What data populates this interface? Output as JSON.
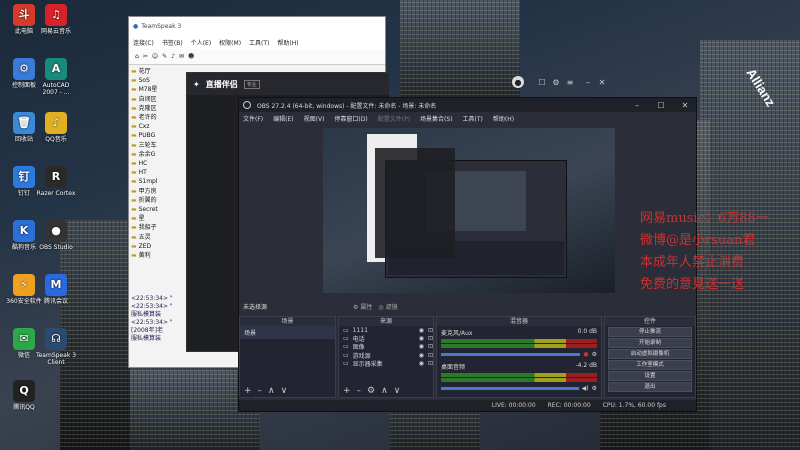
{
  "desktop": {
    "icons": [
      {
        "label": "此电脑",
        "glyph": "斗"
      },
      {
        "label": "网易云音乐",
        "glyph": "♫"
      },
      {
        "label": "控制面板",
        "glyph": "⚙"
      },
      {
        "label": "AutoCAD 2007 - ...",
        "glyph": "A"
      },
      {
        "label": "回收站",
        "glyph": "🗑"
      },
      {
        "label": "QQ音乐",
        "glyph": "♪"
      },
      {
        "label": "钉钉",
        "glyph": "钉"
      },
      {
        "label": "Razer Cortex",
        "glyph": "R"
      },
      {
        "label": "酷狗音乐",
        "glyph": "K"
      },
      {
        "label": "OBS Studio",
        "glyph": "●"
      },
      {
        "label": "360安全软件",
        "glyph": "⚡"
      },
      {
        "label": "腾讯会议",
        "glyph": "M"
      },
      {
        "label": "微信",
        "glyph": "✉"
      },
      {
        "label": "TeamSpeak 3 Client",
        "glyph": "☊"
      },
      {
        "label": "腾讯QQ",
        "glyph": "Q"
      }
    ],
    "overlay_text": "网易music：6万88一\n微博@是小rsuan君\n本成年人禁止消费\n免费的意見送一送",
    "building_text": "Allianz"
  },
  "teamspeak": {
    "title": "TeamSpeak 3",
    "menu": [
      "连接(C)",
      "书签(B)",
      "个人(E)",
      "权限(M)",
      "工具(T)",
      "帮助(H)"
    ],
    "tree": [
      "花厅",
      "SoS",
      "M78星",
      "自闭区",
      "克隆区",
      "老许的",
      "Cxz",
      "PUBG",
      "三轮车",
      "余余G",
      "HC",
      "HT",
      "S1mpl",
      "甲方房",
      "折翼的",
      "Secret",
      "星",
      "我船子",
      "五灵",
      "ZED",
      "黄利"
    ],
    "chat": [
      "<22:53:34> \"",
      "<22:53:34> \"",
      "服私模算装",
      "<22:53:34> \"",
      "[2008年]老",
      "服私模算装"
    ]
  },
  "zhibo": {
    "title": "直播伴侣",
    "badge": "专业"
  },
  "obs": {
    "title": "OBS 27.2.4 (64-bit, windows) - 配置文件: 未命名 - 场景: 未命名",
    "menu": [
      "文件(F)",
      "编辑(E)",
      "视图(V)",
      "停靠窗口(D)",
      "配置文件(P)",
      "场景集合(S)",
      "工具(T)",
      "帮助(H)"
    ],
    "no_source": "未选择源",
    "props": "属性",
    "filters": "滤镜",
    "scenes_header": "场景",
    "scene_item": "场景",
    "sources_header": "来源",
    "sources": [
      "1111",
      "电话",
      "图像",
      "游戏源",
      "显示器采集"
    ],
    "mixer_header": "混音器",
    "mixer": [
      {
        "name": "麦克风/Aux",
        "db": "0.0 dB"
      },
      {
        "name": "桌面音频",
        "db": "-4.2 dB"
      }
    ],
    "controls_header": "控件",
    "controls": [
      "停止推流",
      "开始录制",
      "启动虚拟摄像机",
      "工作室模式",
      "设置",
      "退出"
    ],
    "status": {
      "live": "LIVE: 00:00:00",
      "rec": "REC: 00:00:00",
      "cpu": "CPU: 1.7%, 60.00 fps"
    }
  }
}
